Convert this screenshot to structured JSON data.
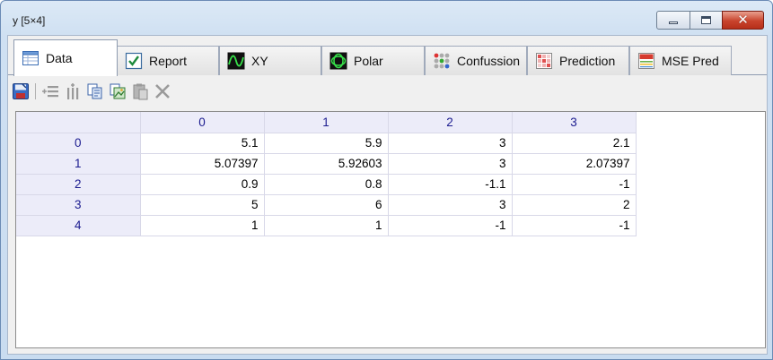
{
  "window": {
    "title": "y [5×4]",
    "minimize_icon": "minimize-icon",
    "maximize_icon": "maximize-icon",
    "close_icon": "close-icon",
    "close_glyph": "✕"
  },
  "tabs": [
    {
      "label": "Data",
      "icon": "table-icon",
      "active": true
    },
    {
      "label": "Report",
      "icon": "checkbox-icon",
      "active": false
    },
    {
      "label": "XY",
      "icon": "waveform-icon",
      "active": false
    },
    {
      "label": "Polar",
      "icon": "polar-icon",
      "active": false
    },
    {
      "label": "Confussion",
      "icon": "dots-matrix-icon",
      "active": false
    },
    {
      "label": "Prediction",
      "icon": "heatmap-grid-icon",
      "active": false
    },
    {
      "label": "MSE Pred",
      "icon": "mse-icon",
      "active": false
    }
  ],
  "toolbar": [
    {
      "icon": "save-icon",
      "enabled": true
    },
    {
      "icon": "add-row-icon",
      "enabled": false
    },
    {
      "icon": "add-column-icon",
      "enabled": false
    },
    {
      "icon": "copy-icon",
      "enabled": true
    },
    {
      "icon": "copy-image-icon",
      "enabled": true
    },
    {
      "icon": "paste-icon",
      "enabled": false
    },
    {
      "icon": "delete-icon",
      "enabled": false
    }
  ],
  "grid": {
    "columns": [
      "0",
      "1",
      "2",
      "3"
    ],
    "rows": [
      {
        "header": "0",
        "cells": [
          "5.1",
          "5.9",
          "3",
          "2.1"
        ]
      },
      {
        "header": "1",
        "cells": [
          "5.07397",
          "5.92603",
          "3",
          "2.07397"
        ]
      },
      {
        "header": "2",
        "cells": [
          "0.9",
          "0.8",
          "-1.1",
          "-1"
        ]
      },
      {
        "header": "3",
        "cells": [
          "5",
          "6",
          "3",
          "2"
        ]
      },
      {
        "header": "4",
        "cells": [
          "1",
          "1",
          "-1",
          "-1"
        ]
      }
    ]
  },
  "colors": {
    "header_bg": "#ececf9",
    "header_text": "#1b1b8f",
    "close_button": "#c8432c"
  }
}
